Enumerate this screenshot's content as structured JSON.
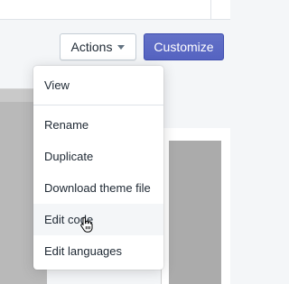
{
  "header": {
    "actions_label": "Actions",
    "customize_label": "Customize"
  },
  "actions_menu": {
    "view": "View",
    "rename": "Rename",
    "duplicate": "Duplicate",
    "download_theme_file": "Download theme file",
    "edit_code": "Edit code",
    "edit_languages": "Edit languages",
    "hovered_item": "Edit code"
  },
  "colors": {
    "primary_button": "#5c6ac4",
    "menu_hover": "#f4f6f8",
    "page_background": "#f4f6f8"
  },
  "icons": {
    "actions_caret": "caret-down-icon",
    "cursor": "hand-pointer-cursor-icon"
  }
}
